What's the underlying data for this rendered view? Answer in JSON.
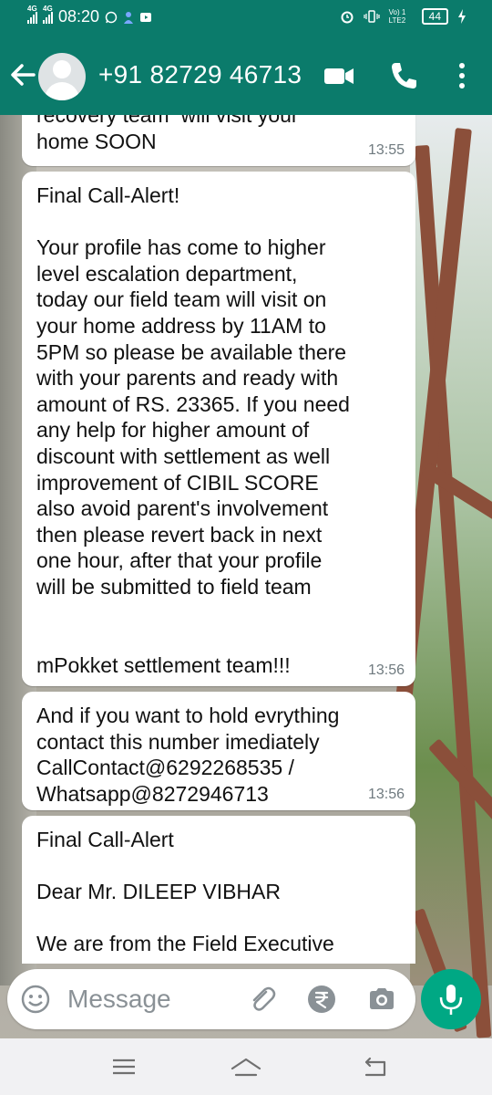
{
  "status_bar": {
    "time": "08:20",
    "net1": "4G",
    "net2": "4G",
    "volte": "Vo) 1 LTE2",
    "battery": "44"
  },
  "app_bar": {
    "contact": "+91 82729 46713"
  },
  "messages": [
    {
      "text": "recovery team  will visit your\nhome SOON",
      "time": "13:55"
    },
    {
      "text": "Final Call-Alert!\n\nYour profile has come to higher\nlevel escalation department,\ntoday our field team will visit on\nyour home address by 11AM to\n5PM so please be available there\nwith your parents and ready with\namount of RS. 23365. If you need\nany help for higher amount of\ndiscount with settlement as well\nimprovement of CIBIL SCORE\nalso avoid parent's involvement\nthen please revert back in next\none hour, after that your profile\nwill be submitted to field team\n\n\nmPokket settlement team!!!",
      "time": "13:56"
    },
    {
      "text": "And if you want to hold evrything\ncontact this number imediately\nCallContact@6292268535 /\nWhatsapp@8272946713",
      "time": "13:56"
    },
    {
      "text": "Final Call-Alert\n\nDear Mr. DILEEP VIBHAR\n\nWe are from the Field Executive",
      "time": ""
    }
  ],
  "composer": {
    "placeholder": "Message"
  },
  "icons": {
    "back": "arrow-left-icon",
    "video": "video-camera-icon",
    "call": "phone-icon",
    "menu": "more-vertical-icon",
    "emoji": "emoji-icon",
    "attach": "paperclip-icon",
    "payment": "rupee-icon",
    "camera": "camera-icon",
    "mic": "microphone-icon"
  },
  "colors": {
    "header": "#0b7b6b",
    "accent": "#00a884",
    "bubble": "#ffffff",
    "timestamp": "#6f7a7f"
  }
}
